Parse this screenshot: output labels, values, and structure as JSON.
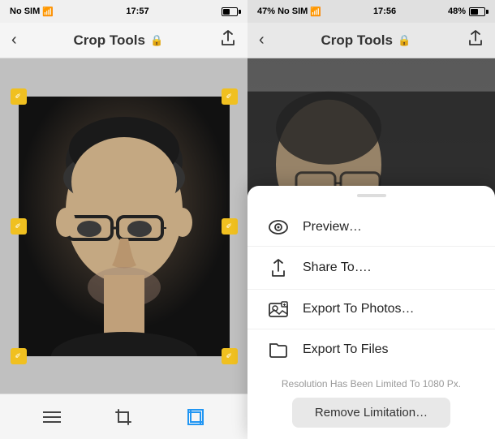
{
  "left": {
    "status": {
      "carrier": "No SIM",
      "time": "17:57",
      "wifi": true
    },
    "header": {
      "title": "Crop Tools",
      "lock_label": "🔒"
    },
    "toolbar": {
      "menu_label": "≡",
      "crop_label": "⬜",
      "active_crop_label": "⬛"
    }
  },
  "right": {
    "status": {
      "carrier": "47%  No SIM",
      "time": "17:56",
      "battery": "48%"
    },
    "header": {
      "title": "Crop Tools",
      "lock_label": "🔒"
    },
    "action_sheet": {
      "handle": "",
      "items": [
        {
          "icon": "👁",
          "label": "Preview…"
        },
        {
          "icon": "⬆",
          "label": "Share To…."
        },
        {
          "icon": "🖼",
          "label": "Export To Photos…"
        },
        {
          "icon": "📁",
          "label": "Export To Files"
        }
      ],
      "resolution_note": "Resolution Has Been Limited To 1080 Px.",
      "remove_btn_label": "Remove Limitation…"
    }
  }
}
